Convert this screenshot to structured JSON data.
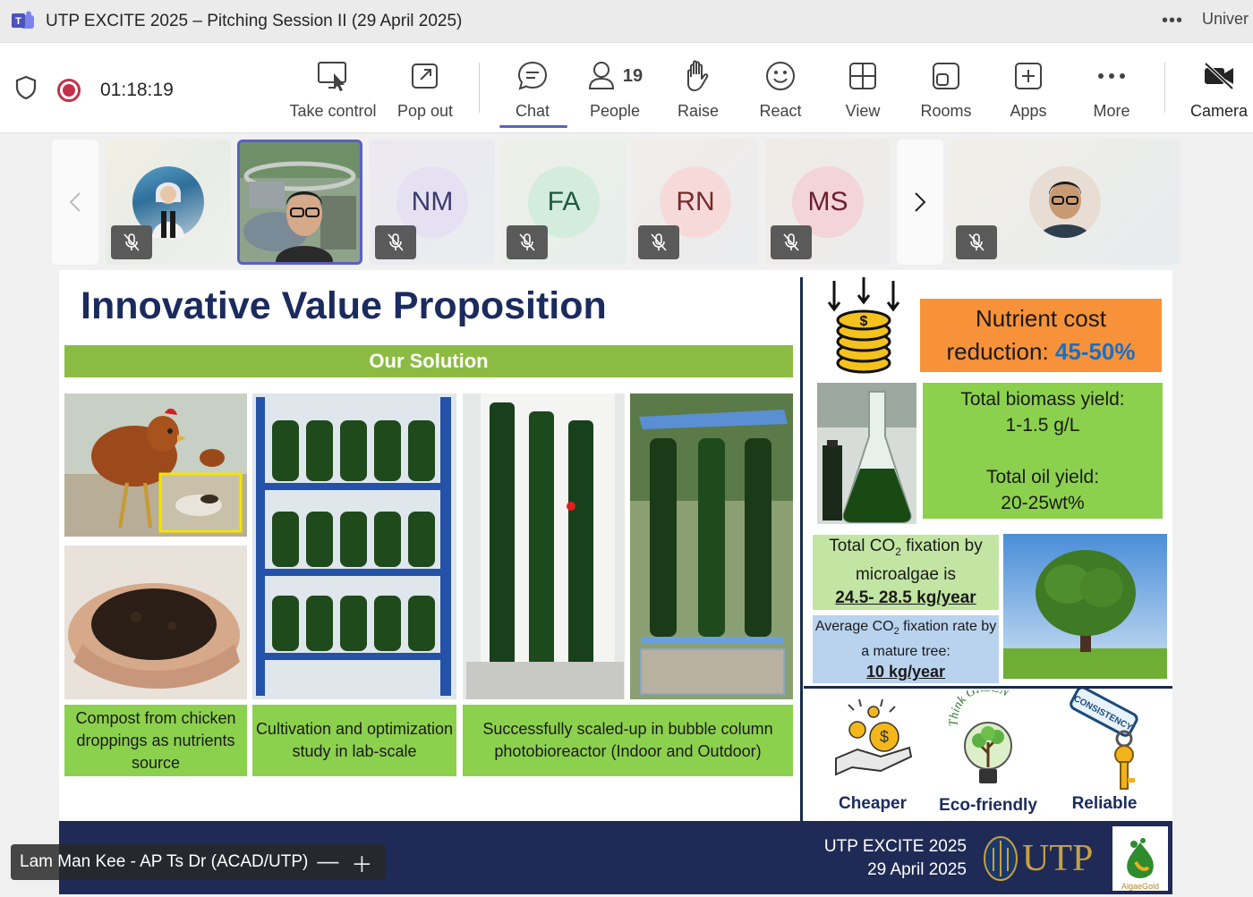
{
  "window": {
    "title": "UTP EXCITE 2025 – Pitching Session II (29 April 2025)",
    "overflow_label": "Univer"
  },
  "toolbar": {
    "timer": "01:18:19",
    "take_control": "Take control",
    "pop_out": "Pop out",
    "chat": "Chat",
    "people": "People",
    "people_count": "19",
    "raise": "Raise",
    "react": "React",
    "view": "View",
    "rooms": "Rooms",
    "apps": "Apps",
    "more": "More",
    "camera": "Camera"
  },
  "participants": [
    {
      "initials": "",
      "muted": true
    },
    {
      "initials": "",
      "muted": false,
      "active": true
    },
    {
      "initials": "NM",
      "muted": true,
      "color": "#e6e0f3",
      "text": "#3b3a6b"
    },
    {
      "initials": "FA",
      "muted": true,
      "color": "#d4ecdc",
      "text": "#1e5a3a"
    },
    {
      "initials": "RN",
      "muted": true,
      "color": "#f6dada",
      "text": "#7a2a2a"
    },
    {
      "initials": "MS",
      "muted": true,
      "color": "#f3d4d8",
      "text": "#6b1e2e"
    },
    {
      "initials": "",
      "muted": true
    }
  ],
  "slide": {
    "title": "Innovative Value Proposition",
    "solution_header": "Our Solution",
    "captions": [
      "Compost from chicken droppings as nutrients source",
      "Cultivation and optimization study in lab-scale",
      "Successfully scaled-up in bubble column photobioreactor (Indoor and Outdoor)"
    ],
    "nutrient_line1": "Nutrient cost",
    "nutrient_line2": "reduction: ",
    "nutrient_value": "45-50%",
    "biomass_label": "Total biomass yield:",
    "biomass_value": "1-1.5 g/L",
    "oil_label": "Total oil yield:",
    "oil_value": "20-25wt%",
    "co2_microalgae_l1": "Total CO",
    "co2_microalgae_l1b": " fixation by",
    "co2_microalgae_l2": "microalgae is",
    "co2_microalgae_value": "24.5- 28.5 kg/year",
    "co2_tree_l1": "Average CO",
    "co2_tree_l1b": " fixation rate by",
    "co2_tree_l2": "a mature tree:",
    "co2_tree_value": "10 kg/year",
    "sub2": "2",
    "benefits": [
      "Cheaper",
      "Eco-friendly",
      "Reliable"
    ],
    "think_green": "Think GREEN",
    "consistency": "CONSISTENCY",
    "footer_event": "UTP EXCITE 2025",
    "footer_date": "29 April 2025",
    "utp_logo": "UTP",
    "algaegold": "AlgaeGold"
  },
  "presenter": {
    "name": "Lam Man Kee - AP Ts Dr (ACAD/UTP)"
  },
  "colors": {
    "accent": "#5b5fc7",
    "record": "#c4314b",
    "slide_green": "#8cd14e",
    "slide_navy": "#1f2b56",
    "orange": "#f7923a"
  }
}
